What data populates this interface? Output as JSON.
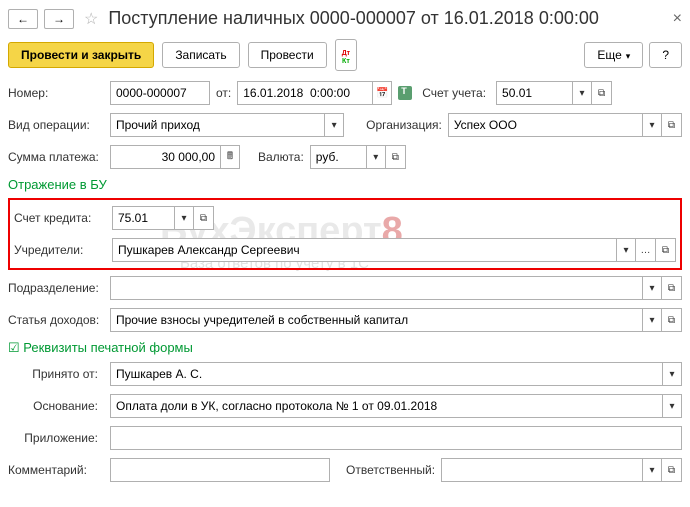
{
  "nav": {
    "back": "←",
    "forward": "→"
  },
  "title": "Поступление наличных 0000-000007 от 16.01.2018 0:00:00",
  "toolbar": {
    "post_close": "Провести и закрыть",
    "save": "Записать",
    "post": "Провести",
    "more": "Еще",
    "help": "?"
  },
  "fields": {
    "number_label": "Номер:",
    "number_value": "0000-000007",
    "from_label": "от:",
    "date_value": "16.01.2018  0:00:00",
    "account_label": "Счет учета:",
    "account_value": "50.01",
    "op_type_label": "Вид операции:",
    "op_type_value": "Прочий приход",
    "org_label": "Организация:",
    "org_value": "Успех ООО",
    "amount_label": "Сумма платежа:",
    "amount_value": "30 000,00",
    "currency_label": "Валюта:",
    "currency_value": "руб."
  },
  "accounting": {
    "section": "Отражение в БУ",
    "credit_label": "Счет кредита:",
    "credit_value": "75.01",
    "founders_label": "Учредители:",
    "founders_value": "Пушкарев Александр Сергеевич",
    "subdiv_label": "Подразделение:",
    "subdiv_value": "",
    "income_label": "Статья доходов:",
    "income_value": "Прочие взносы учредителей в собственный капитал"
  },
  "print": {
    "section": "Реквизиты печатной формы",
    "from_label": "Принято от:",
    "from_value": "Пушкарев А. С.",
    "basis_label": "Основание:",
    "basis_value": "Оплата доли в УК, согласно протокола № 1 от 09.01.2018",
    "attach_label": "Приложение:",
    "attach_value": ""
  },
  "footer": {
    "comment_label": "Комментарий:",
    "comment_value": "",
    "resp_label": "Ответственный:",
    "resp_value": ""
  },
  "watermark": {
    "brand": "БухЭксперт",
    "eight": "8",
    "sub": "База ответов по учету в 1С"
  }
}
